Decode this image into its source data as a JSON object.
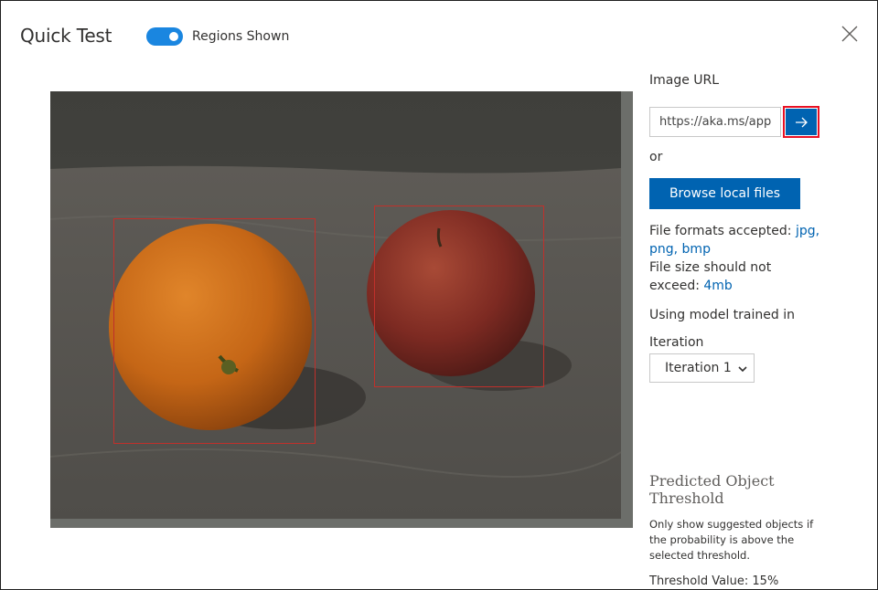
{
  "dialog": {
    "title": "Quick Test",
    "toggle": {
      "label": "Regions Shown",
      "on": true
    },
    "close_icon": "close-icon"
  },
  "sidebar": {
    "image_url_label": "Image URL",
    "image_url_value": "https://aka.ms/app",
    "submit_icon": "arrow-right-icon",
    "or_label": "or",
    "browse_label": "Browse local files",
    "formats_prefix": "File formats accepted:",
    "formats": "jpg, png, bmp",
    "size_prefix": "File size should not exceed:",
    "size_limit": "4mb",
    "model_label": "Using model trained in",
    "iteration_label": "Iteration",
    "iteration_value": "Iteration 1",
    "predicted_title": "Predicted Object Threshold",
    "predicted_desc": "Only show suggested objects if the probability is above the selected threshold.",
    "threshold_label": "Threshold Value: 15%"
  },
  "colors": {
    "accent": "#0063b1",
    "toggle": "#1a86e0",
    "highlight": "#e81123",
    "region_box": "#c0302b"
  }
}
